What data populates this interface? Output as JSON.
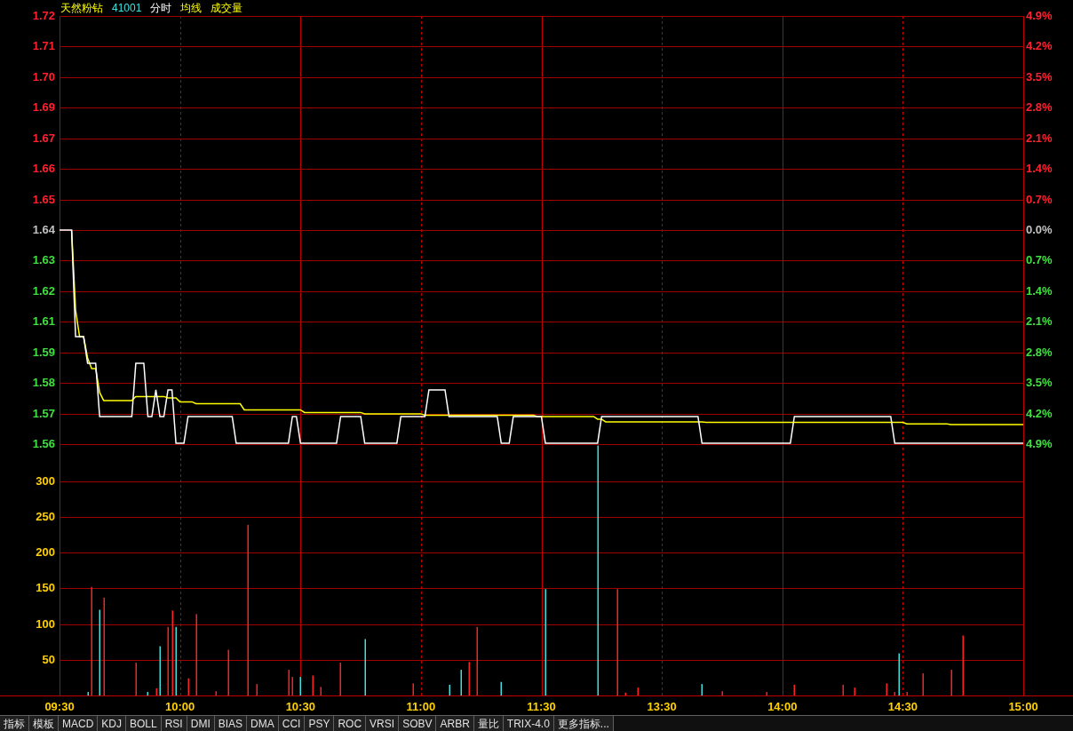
{
  "header": {
    "name": "天然粉钻",
    "code": "41001",
    "mode": "分时",
    "average": "均线",
    "volume": "成交量"
  },
  "price_chart": {
    "percent_axis": [
      "4.9%",
      "4.2%",
      "3.5%",
      "2.8%",
      "2.1%",
      "1.4%",
      "0.7%",
      "0.0%",
      "0.7%",
      "1.4%",
      "2.1%",
      "2.8%",
      "3.5%",
      "4.2%",
      "4.9%"
    ],
    "chart_data": {
      "type": "line",
      "grid": true,
      "ylim": [
        1.55964,
        1.72036
      ],
      "yticks": [
        {
          "value": 1.72036,
          "label": "1.72"
        },
        {
          "value": 1.70888,
          "label": "1.71"
        },
        {
          "value": 1.6974,
          "label": "1.70"
        },
        {
          "value": 1.68592,
          "label": "1.69"
        },
        {
          "value": 1.67444,
          "label": "1.67"
        },
        {
          "value": 1.66296,
          "label": "1.66"
        },
        {
          "value": 1.65148,
          "label": "1.65"
        },
        {
          "value": 1.64,
          "label": "1.64"
        },
        {
          "value": 1.62852,
          "label": "1.63"
        },
        {
          "value": 1.61704,
          "label": "1.62"
        },
        {
          "value": 1.60556,
          "label": "1.61"
        },
        {
          "value": 1.59408,
          "label": "1.59"
        },
        {
          "value": 1.5826,
          "label": "1.58"
        },
        {
          "value": 1.57112,
          "label": "1.57"
        },
        {
          "value": 1.55964,
          "label": "1.56"
        }
      ],
      "series": [
        {
          "color": "#ffffff",
          "values": [
            1.64,
            1.64,
            1.64,
            1.64,
            1.6,
            1.6,
            1.6,
            1.59,
            1.59,
            1.59,
            1.57,
            1.57,
            1.57,
            1.57,
            1.57,
            1.57,
            1.57,
            1.57,
            1.57,
            1.59,
            1.59,
            1.59,
            1.57,
            1.57,
            1.58,
            1.57,
            1.57,
            1.58,
            1.58,
            1.56,
            1.56,
            1.56,
            1.57,
            1.57,
            1.57,
            1.57,
            1.57,
            1.57,
            1.57,
            1.57,
            1.57,
            1.57,
            1.57,
            1.57,
            1.56,
            1.56,
            1.56,
            1.56,
            1.56,
            1.56,
            1.56,
            1.56,
            1.56,
            1.56,
            1.56,
            1.56,
            1.56,
            1.56,
            1.57,
            1.57,
            1.56,
            1.56,
            1.56,
            1.56,
            1.56,
            1.56,
            1.56,
            1.56,
            1.56,
            1.56,
            1.57,
            1.57,
            1.57,
            1.57,
            1.57,
            1.57,
            1.56,
            1.56,
            1.56,
            1.56,
            1.56,
            1.56,
            1.56,
            1.56,
            1.56,
            1.57,
            1.57,
            1.57,
            1.57,
            1.57,
            1.57,
            1.57,
            1.58,
            1.58,
            1.58,
            1.58,
            1.58,
            1.57,
            1.57,
            1.57,
            1.57,
            1.57,
            1.57,
            1.57,
            1.57,
            1.57,
            1.57,
            1.57,
            1.57,
            1.57,
            1.56,
            1.56,
            1.56,
            1.57,
            1.57,
            1.57,
            1.57,
            1.57,
            1.57,
            1.57,
            1.57,
            1.56,
            1.56,
            1.56,
            1.56,
            1.56,
            1.56,
            1.56,
            1.56,
            1.56,
            1.56,
            1.56,
            1.56,
            1.56,
            1.56,
            1.57,
            1.57,
            1.57,
            1.57,
            1.57,
            1.57,
            1.57,
            1.57,
            1.57,
            1.57,
            1.57,
            1.57,
            1.57,
            1.57,
            1.57,
            1.57,
            1.57,
            1.57,
            1.57,
            1.57,
            1.57,
            1.57,
            1.57,
            1.57,
            1.57,
            1.56,
            1.56,
            1.56,
            1.56,
            1.56,
            1.56,
            1.56,
            1.56,
            1.56,
            1.56,
            1.56,
            1.56,
            1.56,
            1.56,
            1.56,
            1.56,
            1.56,
            1.56,
            1.56,
            1.56,
            1.56,
            1.56,
            1.56,
            1.57,
            1.57,
            1.57,
            1.57,
            1.57,
            1.57,
            1.57,
            1.57,
            1.57,
            1.57,
            1.57,
            1.57,
            1.57,
            1.57,
            1.57,
            1.57,
            1.57,
            1.57,
            1.57,
            1.57,
            1.57,
            1.57,
            1.57,
            1.57,
            1.57,
            1.56,
            1.56,
            1.56,
            1.56,
            1.56,
            1.56,
            1.56,
            1.56,
            1.56,
            1.56,
            1.56,
            1.56,
            1.56,
            1.56,
            1.56,
            1.56,
            1.56,
            1.56,
            1.56,
            1.56,
            1.56,
            1.56,
            1.56,
            1.56,
            1.56,
            1.56,
            1.56,
            1.56,
            1.56,
            1.56,
            1.56,
            1.56,
            1.56
          ]
        },
        {
          "color": "#ffff00",
          "values": [
            null,
            null,
            null,
            1.64,
            1.61,
            1.6,
            1.6,
            1.592,
            1.588,
            1.588,
            1.579,
            1.576,
            1.576,
            1.576,
            1.576,
            1.576,
            1.576,
            1.576,
            1.576,
            1.5775,
            1.5775,
            1.5775,
            1.5775,
            1.5775,
            1.5775,
            1.5775,
            1.5775,
            1.577,
            1.577,
            1.577,
            1.5755,
            1.5755,
            1.5755,
            1.5755,
            1.5748,
            1.5748,
            1.5748,
            1.5748,
            1.5748,
            1.5748,
            1.5748,
            1.5748,
            1.5748,
            1.5748,
            1.5748,
            1.5748,
            1.5725,
            1.5725,
            1.5725,
            1.5725,
            1.5725,
            1.5725,
            1.5725,
            1.5725,
            1.5725,
            1.5725,
            1.5725,
            1.5725,
            1.5725,
            1.5725,
            1.5725,
            1.5715,
            1.5715,
            1.5715,
            1.5715,
            1.5715,
            1.5715,
            1.5715,
            1.5715,
            1.5715,
            1.5715,
            1.5715,
            1.5715,
            1.5715,
            1.5715,
            1.5715,
            1.571,
            1.571,
            1.571,
            1.571,
            1.571,
            1.571,
            1.571,
            1.571,
            1.571,
            1.571,
            1.571,
            1.571,
            1.571,
            1.571,
            1.571,
            1.5705,
            1.5705,
            1.5705,
            1.5705,
            1.5705,
            1.5705,
            1.5705,
            1.5705,
            1.5705,
            1.5705,
            1.5705,
            1.5705,
            1.5705,
            1.5705,
            1.5705,
            1.5705,
            1.5705,
            1.5705,
            1.5705,
            1.5705,
            1.5705,
            1.5705,
            1.5705,
            1.5705,
            1.5705,
            1.5705,
            1.5705,
            1.5705,
            1.57,
            1.57,
            1.57,
            1.57,
            1.57,
            1.57,
            1.57,
            1.57,
            1.57,
            1.57,
            1.57,
            1.57,
            1.57,
            1.57,
            1.57,
            1.569,
            1.569,
            1.568,
            1.568,
            1.568,
            1.568,
            1.568,
            1.568,
            1.568,
            1.568,
            1.568,
            1.568,
            1.568,
            1.568,
            1.568,
            1.568,
            1.568,
            1.568,
            1.568,
            1.568,
            1.568,
            1.568,
            1.568,
            1.568,
            1.568,
            1.568,
            1.568,
            1.5678,
            1.5678,
            1.5678,
            1.5678,
            1.5678,
            1.5678,
            1.5678,
            1.5678,
            1.5678,
            1.5678,
            1.5678,
            1.5678,
            1.5678,
            1.5678,
            1.5678,
            1.5678,
            1.5678,
            1.5678,
            1.5678,
            1.5678,
            1.5678,
            1.5678,
            1.5678,
            1.5678,
            1.5678,
            1.5678,
            1.5678,
            1.5678,
            1.5678,
            1.5678,
            1.5678,
            1.5678,
            1.5678,
            1.5678,
            1.5678,
            1.5678,
            1.5678,
            1.5678,
            1.5678,
            1.5678,
            1.5678,
            1.5678,
            1.5678,
            1.5678,
            1.5678,
            1.5678,
            1.5678,
            1.5678,
            1.5678,
            1.5678,
            1.5672,
            1.5672,
            1.5672,
            1.5672,
            1.5672,
            1.5672,
            1.5672,
            1.5672,
            1.5672,
            1.5672,
            1.5672,
            1.567,
            1.567,
            1.567,
            1.567,
            1.567,
            1.567,
            1.567,
            1.567,
            1.567,
            1.567,
            1.567,
            1.567,
            1.567,
            1.567,
            1.567,
            1.567,
            1.567,
            1.567,
            1.567
          ]
        }
      ]
    }
  },
  "volume_chart": {
    "chart_data": {
      "type": "bar",
      "grid": true,
      "ylim": [
        0,
        352
      ],
      "yticks": [
        50,
        100,
        150,
        200,
        250,
        300
      ],
      "categories": [
        "09:30",
        null,
        null,
        null,
        null,
        null,
        null,
        null,
        null,
        null,
        null,
        null,
        null,
        null,
        null,
        null,
        null,
        null,
        null,
        null,
        null,
        null,
        null,
        null,
        null,
        null,
        null,
        null,
        null,
        null,
        "10:00",
        null,
        null,
        null,
        null,
        null,
        null,
        null,
        null,
        null,
        null,
        null,
        null,
        null,
        null,
        null,
        null,
        null,
        null,
        null,
        null,
        null,
        null,
        null,
        null,
        null,
        null,
        null,
        null,
        null,
        "10:30",
        null,
        null,
        null,
        null,
        null,
        null,
        null,
        null,
        null,
        null,
        null,
        null,
        null,
        null,
        null,
        null,
        null,
        null,
        null,
        null,
        null,
        null,
        null,
        null,
        null,
        null,
        null,
        null,
        null,
        "11:00",
        null,
        null,
        null,
        null,
        null,
        null,
        null,
        null,
        null,
        null,
        null,
        null,
        null,
        null,
        null,
        null,
        null,
        null,
        null,
        null,
        null,
        null,
        null,
        null,
        null,
        null,
        null,
        null,
        null,
        "11:30",
        null,
        null,
        null,
        null,
        null,
        null,
        null,
        null,
        null,
        null,
        null,
        null,
        null,
        null,
        null,
        null,
        null,
        null,
        null,
        null,
        null,
        null,
        null,
        null,
        null,
        null,
        null,
        null,
        null,
        "13:30",
        null,
        null,
        null,
        null,
        null,
        null,
        null,
        null,
        null,
        null,
        null,
        null,
        null,
        null,
        null,
        null,
        null,
        null,
        null,
        null,
        null,
        null,
        null,
        null,
        null,
        null,
        null,
        null,
        null,
        "14:00",
        null,
        null,
        null,
        null,
        null,
        null,
        null,
        null,
        null,
        null,
        null,
        null,
        null,
        null,
        null,
        null,
        null,
        null,
        null,
        null,
        null,
        null,
        null,
        null,
        null,
        null,
        null,
        null,
        null,
        "14:30",
        null,
        null,
        null,
        null,
        null,
        null,
        null,
        null,
        null,
        null,
        null,
        null,
        null,
        null,
        null,
        null,
        null,
        null,
        null,
        null,
        null,
        null,
        null,
        null,
        null,
        null,
        null,
        null,
        null,
        "15:00"
      ],
      "series": [
        {
          "color": "#ff2020",
          "values": [
            null,
            null,
            null,
            null,
            null,
            null,
            null,
            null,
            152,
            null,
            null,
            137,
            null,
            null,
            null,
            null,
            null,
            null,
            null,
            46,
            null,
            null,
            null,
            null,
            10,
            null,
            null,
            96,
            119,
            null,
            null,
            null,
            24,
            null,
            114,
            null,
            null,
            null,
            null,
            6,
            null,
            null,
            64,
            null,
            null,
            null,
            null,
            239,
            null,
            16,
            null,
            null,
            null,
            null,
            null,
            null,
            null,
            36,
            26,
            null,
            null,
            null,
            null,
            28,
            null,
            12,
            null,
            null,
            null,
            null,
            46,
            null,
            null,
            null,
            null,
            null,
            null,
            null,
            null,
            null,
            null,
            null,
            null,
            null,
            null,
            null,
            null,
            null,
            17,
            null,
            null,
            null,
            null,
            null,
            null,
            null,
            null,
            null,
            null,
            null,
            null,
            null,
            47,
            null,
            96,
            null,
            null,
            null,
            null,
            null,
            null,
            null,
            null,
            null,
            null,
            null,
            null,
            null,
            null,
            null,
            null,
            null,
            null,
            null,
            null,
            null,
            null,
            null,
            null,
            null,
            null,
            null,
            null,
            null,
            null,
            null,
            null,
            null,
            null,
            149,
            null,
            4,
            null,
            null,
            11,
            null,
            null,
            null,
            null,
            null,
            null,
            null,
            null,
            null,
            null,
            null,
            null,
            null,
            null,
            null,
            null,
            null,
            null,
            null,
            null,
            6,
            null,
            null,
            null,
            null,
            null,
            null,
            null,
            null,
            null,
            null,
            5,
            null,
            null,
            null,
            null,
            null,
            null,
            15,
            null,
            null,
            null,
            null,
            null,
            null,
            null,
            null,
            null,
            null,
            null,
            15,
            null,
            null,
            11,
            null,
            null,
            null,
            null,
            null,
            null,
            null,
            17,
            null,
            5,
            null,
            null,
            5,
            null,
            null,
            null,
            31,
            null,
            null,
            null,
            null,
            null,
            null,
            36,
            null,
            null,
            84,
            null,
            null,
            null,
            null,
            null,
            null,
            null,
            null,
            null,
            null,
            null,
            null,
            null,
            null,
            null
          ]
        },
        {
          "color": "#40e0e0",
          "values": [
            null,
            null,
            null,
            null,
            null,
            null,
            null,
            5,
            null,
            null,
            120,
            null,
            null,
            null,
            null,
            null,
            null,
            null,
            null,
            null,
            null,
            null,
            5,
            null,
            null,
            69,
            null,
            null,
            null,
            96,
            null,
            null,
            null,
            null,
            null,
            null,
            null,
            null,
            null,
            null,
            null,
            null,
            null,
            null,
            null,
            null,
            null,
            null,
            null,
            null,
            null,
            null,
            null,
            null,
            null,
            null,
            null,
            null,
            null,
            null,
            26,
            null,
            null,
            null,
            null,
            null,
            null,
            null,
            null,
            null,
            null,
            null,
            null,
            null,
            null,
            null,
            79,
            null,
            null,
            null,
            null,
            null,
            null,
            null,
            null,
            null,
            null,
            null,
            null,
            null,
            null,
            null,
            null,
            null,
            null,
            null,
            null,
            15,
            null,
            null,
            36,
            null,
            null,
            null,
            null,
            null,
            null,
            null,
            null,
            null,
            19,
            null,
            null,
            null,
            null,
            null,
            null,
            null,
            null,
            null,
            null,
            149,
            null,
            null,
            null,
            null,
            null,
            null,
            null,
            null,
            null,
            null,
            null,
            null,
            350,
            null,
            null,
            null,
            null,
            null,
            null,
            null,
            null,
            null,
            null,
            null,
            null,
            null,
            null,
            null,
            null,
            null,
            null,
            null,
            null,
            null,
            null,
            null,
            null,
            null,
            16,
            null,
            null,
            null,
            null,
            null,
            null,
            null,
            null,
            null,
            null,
            null,
            null,
            null,
            null,
            null,
            null,
            null,
            null,
            null,
            null,
            null,
            null,
            null,
            null,
            null,
            null,
            null,
            null,
            null,
            null,
            null,
            null,
            null,
            null,
            null,
            null,
            null,
            null,
            null,
            null,
            null,
            null,
            null,
            null,
            null,
            null,
            null,
            null,
            59,
            null,
            null,
            null,
            null,
            null,
            null,
            null,
            null,
            null,
            null,
            null,
            null,
            null,
            null,
            null,
            null,
            null,
            null,
            null,
            null,
            null,
            null,
            null,
            null,
            null,
            null,
            null,
            null,
            null,
            null,
            null
          ]
        }
      ]
    }
  },
  "tabs": [
    "指标",
    "模板",
    "MACD",
    "KDJ",
    "BOLL",
    "RSI",
    "DMI",
    "BIAS",
    "DMA",
    "CCI",
    "PSY",
    "ROC",
    "VRSI",
    "SOBV",
    "ARBR",
    "量比",
    "TRIX-4.0",
    "更多指标..."
  ]
}
